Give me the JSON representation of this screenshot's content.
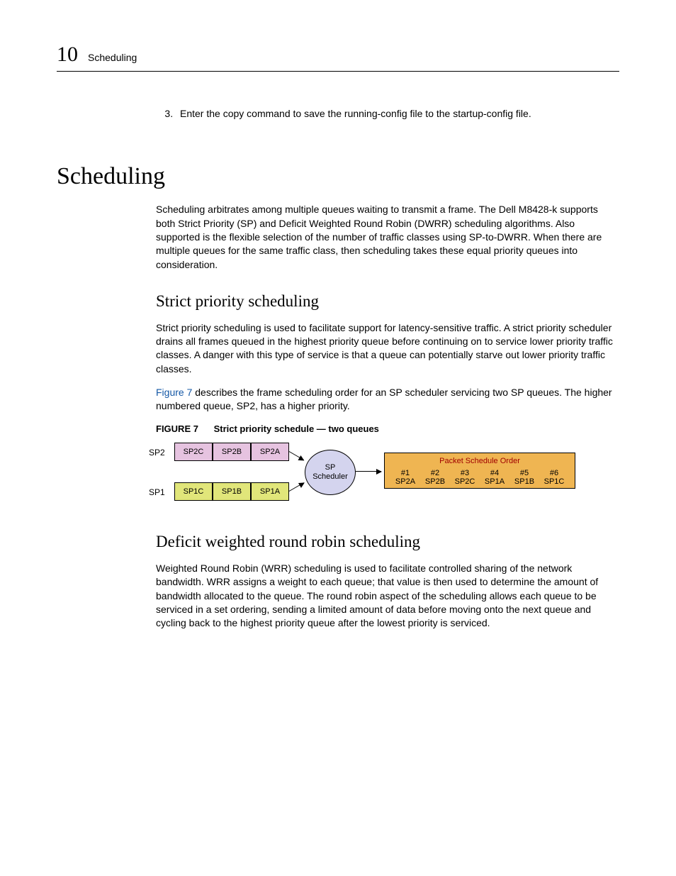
{
  "header": {
    "chapter_number": "10",
    "chapter_title": "Scheduling"
  },
  "step": {
    "number": "3.",
    "text": "Enter the copy command to save the running-config file to the startup-config file."
  },
  "h1": "Scheduling",
  "intro": "Scheduling arbitrates among multiple queues waiting to transmit a frame. The Dell M8428-k supports both Strict Priority (SP) and Deficit Weighted Round Robin (DWRR) scheduling algorithms. Also supported is the flexible selection of the number of traffic classes using SP-to-DWRR. When there are multiple queues for the same traffic class, then scheduling takes these equal priority queues into consideration.",
  "sp": {
    "heading": "Strict priority scheduling",
    "p1": "Strict priority scheduling is used to facilitate support for latency-sensitive traffic. A strict priority scheduler drains all frames queued in the highest priority queue before continuing on to service lower priority traffic classes. A danger with this type of service is that a queue can potentially starve out lower priority traffic classes.",
    "p2_link": "Figure 7",
    "p2_rest": " describes the frame scheduling order for an SP scheduler servicing two SP queues. The higher numbered queue, SP2, has a higher priority."
  },
  "figure": {
    "label": "FIGURE 7",
    "caption": "Strict priority schedule — two queues",
    "sp2_label": "SP2",
    "sp1_label": "SP1",
    "sp2_cells": [
      "SP2C",
      "SP2B",
      "SP2A"
    ],
    "sp1_cells": [
      "SP1C",
      "SP1B",
      "SP1A"
    ],
    "scheduler_l1": "SP",
    "scheduler_l2": "Scheduler",
    "order_title": "Packet Schedule Order",
    "order_nums": [
      "#1",
      "#2",
      "#3",
      "#4",
      "#5",
      "#6"
    ],
    "order_vals": [
      "SP2A",
      "SP2B",
      "SP2C",
      "SP1A",
      "SP1B",
      "SP1C"
    ]
  },
  "dwrr": {
    "heading": "Deficit weighted round robin scheduling",
    "p1": "Weighted Round Robin (WRR) scheduling is used to facilitate controlled sharing of the network bandwidth. WRR assigns a weight to each queue; that value is then used to determine the amount of bandwidth allocated to the queue. The round robin aspect of the scheduling allows each queue to be serviced in a set ordering, sending a limited amount of data before moving onto the next queue and cycling back to the highest priority queue after the lowest priority is serviced."
  },
  "chart_data": {
    "type": "table",
    "title": "Strict priority schedule — two queues",
    "input_queues": {
      "SP2": [
        "SP2C",
        "SP2B",
        "SP2A"
      ],
      "SP1": [
        "SP1C",
        "SP1B",
        "SP1A"
      ]
    },
    "scheduler": "SP Scheduler",
    "output_order": [
      {
        "pos": 1,
        "packet": "SP2A"
      },
      {
        "pos": 2,
        "packet": "SP2B"
      },
      {
        "pos": 3,
        "packet": "SP2C"
      },
      {
        "pos": 4,
        "packet": "SP1A"
      },
      {
        "pos": 5,
        "packet": "SP1B"
      },
      {
        "pos": 6,
        "packet": "SP1C"
      }
    ]
  }
}
